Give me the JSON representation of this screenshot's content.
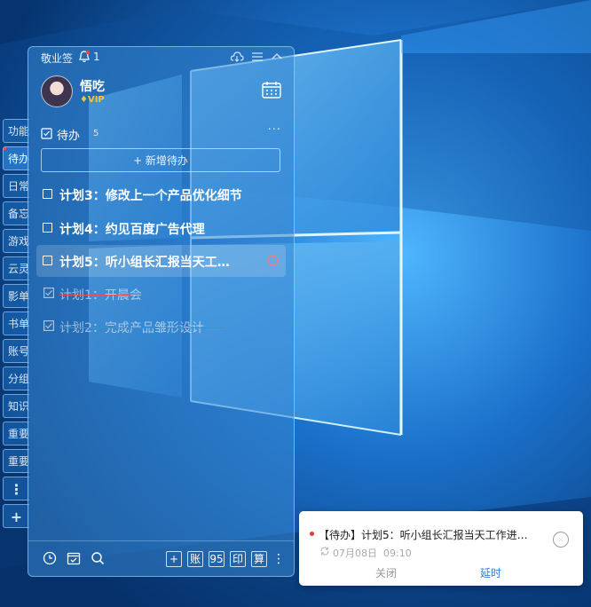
{
  "app": {
    "title": "敬业签",
    "notification_count": "1"
  },
  "profile": {
    "username": "悟吃",
    "badge": "VIP"
  },
  "side_tabs": [
    "功能",
    "待办",
    "日常",
    "备忘",
    "游戏",
    "云灵",
    "影单",
    "书单",
    "账号",
    "分组",
    "知识",
    "重要",
    "重要"
  ],
  "todo_section": {
    "label": "待办",
    "count": "5",
    "new_button": "+ 新增待办"
  },
  "todos": [
    {
      "text": "计划3：修改上一个产品优化细节",
      "done": false
    },
    {
      "text": "计划4：约见百度广告代理",
      "done": false
    },
    {
      "text": "计划5：听小组长汇报当天工…",
      "done": false,
      "has_reminder": true
    },
    {
      "text": "计划1：开晨会",
      "done": true
    },
    {
      "text": "计划2：完成产品雏形设计",
      "done": true
    }
  ],
  "bottom_buttons": [
    "+",
    "账",
    "95",
    "印",
    "算"
  ],
  "notification": {
    "title": "【待办】计划5：听小组长汇报当天工作进…",
    "date": "07月08日",
    "time": "09:10",
    "close_label": "关闭",
    "delay_label": "延时"
  },
  "colors": {
    "accent": "#2a7fd0",
    "strike": "#e05555",
    "vip": "#f5c23b",
    "alert_dot": "#e03b3b"
  }
}
